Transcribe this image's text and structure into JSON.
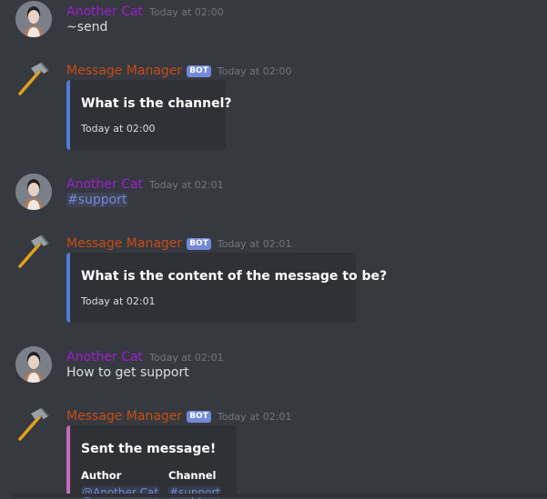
{
  "messages": [
    {
      "author": "Another Cat",
      "timestamp": "Today at 02:00",
      "text": "~send"
    },
    {
      "author": "Message Manager",
      "badge": "BOT",
      "timestamp": "Today at 02:00",
      "embed": {
        "title": "What is the channel?",
        "footer": "Today at 02:00"
      }
    },
    {
      "author": "Another Cat",
      "timestamp": "Today at 02:01",
      "text": "#support"
    },
    {
      "author": "Message Manager",
      "badge": "BOT",
      "timestamp": "Today at 02:01",
      "embed": {
        "title": "What is the content of the message to be?",
        "footer": "Today at 02:01"
      }
    },
    {
      "author": "Another Cat",
      "timestamp": "Today at 02:01",
      "text": "How to get support"
    },
    {
      "author": "Message Manager",
      "badge": "BOT",
      "timestamp": "Today at 02:01",
      "embed": {
        "title": "Sent the message!",
        "fields": [
          {
            "name": "Author",
            "value": "@Another Cat"
          },
          {
            "name": "Channel",
            "value": "#support"
          }
        ]
      }
    }
  ],
  "colors": {
    "user_name": "#9b1fd1",
    "bot_name": "#c84b14",
    "embed_blue": "#4f7ed4",
    "embed_pink": "#c86bc0",
    "mention": "#7289da"
  }
}
